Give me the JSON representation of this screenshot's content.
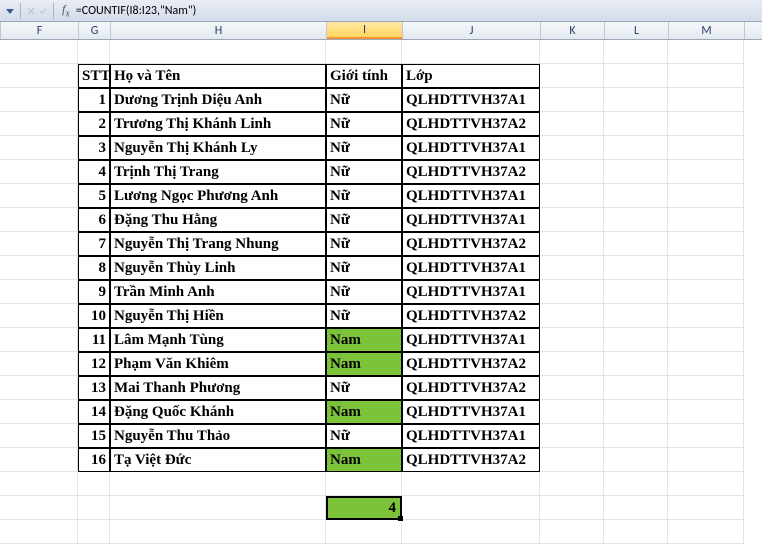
{
  "formula": "=COUNTIF(I8:I23,\"Nam\")",
  "columns": [
    "F",
    "G",
    "H",
    "I",
    "J",
    "K",
    "L",
    "M"
  ],
  "selected_column": "I",
  "headers": {
    "stt": "STT",
    "hoten": "Họ và Tên",
    "gioitinh": "Giới tính",
    "lop": "Lớp"
  },
  "rows": [
    {
      "stt": "1",
      "name": "Dương Trịnh Diệu Anh",
      "sex": "Nữ",
      "class": "QLHDTTVH37A1",
      "hl": false
    },
    {
      "stt": "2",
      "name": "Trương Thị Khánh Linh",
      "sex": "Nữ",
      "class": "QLHDTTVH37A2",
      "hl": false
    },
    {
      "stt": "3",
      "name": "Nguyễn Thị Khánh Ly",
      "sex": "Nữ",
      "class": "QLHDTTVH37A1",
      "hl": false
    },
    {
      "stt": "4",
      "name": "Trịnh Thị Trang",
      "sex": "Nữ",
      "class": "QLHDTTVH37A2",
      "hl": false
    },
    {
      "stt": "5",
      "name": "Lương Ngọc Phương Anh",
      "sex": "Nữ",
      "class": "QLHDTTVH37A1",
      "hl": false
    },
    {
      "stt": "6",
      "name": "Đặng Thu Hằng",
      "sex": "Nữ",
      "class": "QLHDTTVH37A1",
      "hl": false
    },
    {
      "stt": "7",
      "name": "Nguyễn Thị Trang Nhung",
      "sex": "Nữ",
      "class": "QLHDTTVH37A2",
      "hl": false
    },
    {
      "stt": "8",
      "name": "Nguyễn Thùy Linh",
      "sex": "Nữ",
      "class": "QLHDTTVH37A1",
      "hl": false
    },
    {
      "stt": "9",
      "name": "Trần Minh Anh",
      "sex": "Nữ",
      "class": "QLHDTTVH37A1",
      "hl": false
    },
    {
      "stt": "10",
      "name": "Nguyễn Thị Hiền",
      "sex": "Nữ",
      "class": "QLHDTTVH37A2",
      "hl": false
    },
    {
      "stt": "11",
      "name": "Lâm Mạnh Tùng",
      "sex": "Nam",
      "class": "QLHDTTVH37A1",
      "hl": true
    },
    {
      "stt": "12",
      "name": "Phạm Văn Khiêm",
      "sex": "Nam",
      "class": "QLHDTTVH37A2",
      "hl": true
    },
    {
      "stt": "13",
      "name": "Mai Thanh Phương",
      "sex": "Nữ",
      "class": "QLHDTTVH37A2",
      "hl": false
    },
    {
      "stt": "14",
      "name": "Đặng Quốc Khánh",
      "sex": "Nam",
      "class": "QLHDTTVH37A1",
      "hl": true
    },
    {
      "stt": "15",
      "name": "Nguyễn Thu Thảo",
      "sex": "Nữ",
      "class": "QLHDTTVH37A1",
      "hl": false
    },
    {
      "stt": "16",
      "name": "Tạ Việt Đức",
      "sex": "Nam",
      "class": "QLHDTTVH37A2",
      "hl": true
    }
  ],
  "result": "4"
}
